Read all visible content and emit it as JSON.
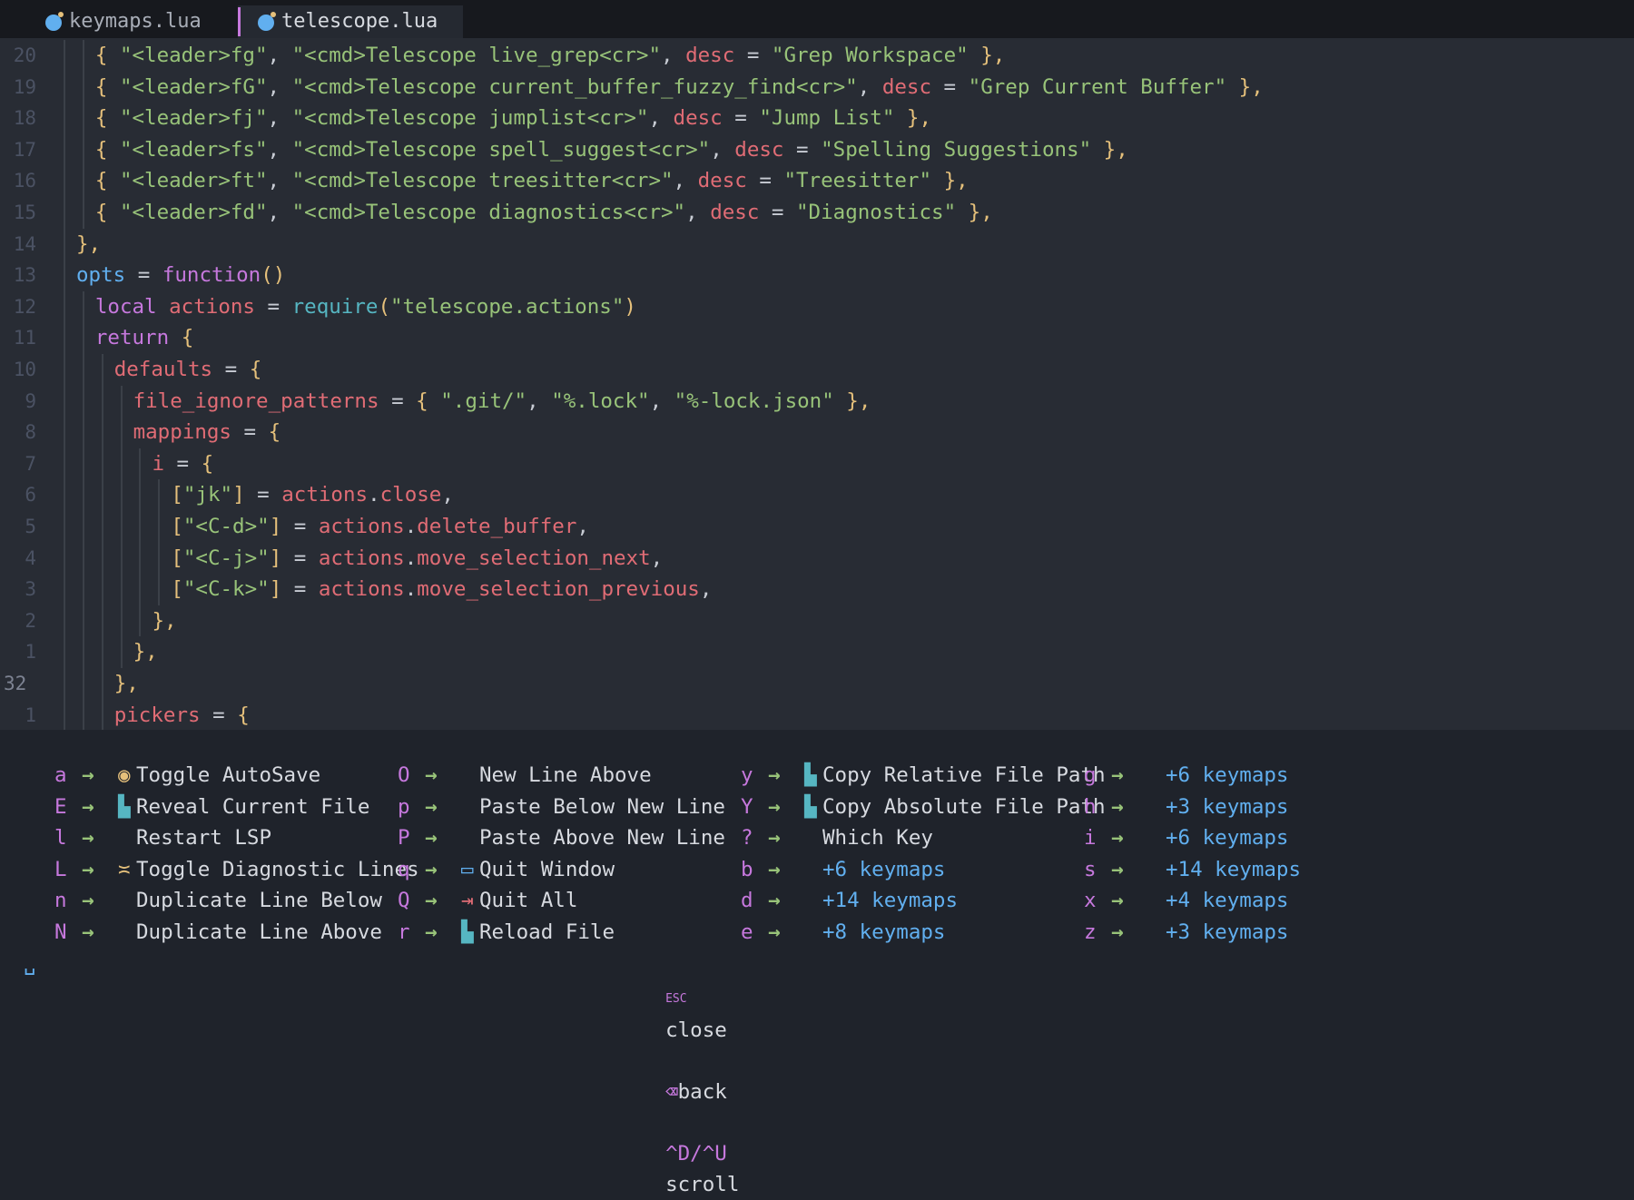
{
  "tabs": [
    {
      "label": "keymaps.lua",
      "active": false
    },
    {
      "label": "telescope.lua",
      "active": true
    }
  ],
  "lines": [
    {
      "num": "20",
      "indent": 2,
      "tokens": [
        [
          "{ ",
          "brace"
        ],
        [
          "\"<leader>fg\"",
          "str"
        ],
        [
          ", ",
          "punc"
        ],
        [
          "\"<cmd>Telescope live_grep<cr>\"",
          "str"
        ],
        [
          ", ",
          "punc"
        ],
        [
          "desc",
          "field"
        ],
        [
          " = ",
          "punc"
        ],
        [
          "\"Grep Workspace\"",
          "str"
        ],
        [
          " },",
          "brace"
        ]
      ]
    },
    {
      "num": "19",
      "indent": 2,
      "tokens": [
        [
          "{ ",
          "brace"
        ],
        [
          "\"<leader>fG\"",
          "str"
        ],
        [
          ", ",
          "punc"
        ],
        [
          "\"<cmd>Telescope current_buffer_fuzzy_find<cr>\"",
          "str"
        ],
        [
          ", ",
          "punc"
        ],
        [
          "desc",
          "field"
        ],
        [
          " = ",
          "punc"
        ],
        [
          "\"Grep Current Buffer\"",
          "str"
        ],
        [
          " },",
          "brace"
        ]
      ]
    },
    {
      "num": "18",
      "indent": 2,
      "tokens": [
        [
          "{ ",
          "brace"
        ],
        [
          "\"<leader>fj\"",
          "str"
        ],
        [
          ", ",
          "punc"
        ],
        [
          "\"<cmd>Telescope jumplist<cr>\"",
          "str"
        ],
        [
          ", ",
          "punc"
        ],
        [
          "desc",
          "field"
        ],
        [
          " = ",
          "punc"
        ],
        [
          "\"Jump List\"",
          "str"
        ],
        [
          " },",
          "brace"
        ]
      ]
    },
    {
      "num": "17",
      "indent": 2,
      "tokens": [
        [
          "{ ",
          "brace"
        ],
        [
          "\"<leader>fs\"",
          "str"
        ],
        [
          ", ",
          "punc"
        ],
        [
          "\"<cmd>Telescope spell_suggest<cr>\"",
          "str"
        ],
        [
          ", ",
          "punc"
        ],
        [
          "desc",
          "field"
        ],
        [
          " = ",
          "punc"
        ],
        [
          "\"Spelling Suggestions\"",
          "str"
        ],
        [
          " },",
          "brace"
        ]
      ]
    },
    {
      "num": "16",
      "indent": 2,
      "tokens": [
        [
          "{ ",
          "brace"
        ],
        [
          "\"<leader>ft\"",
          "str"
        ],
        [
          ", ",
          "punc"
        ],
        [
          "\"<cmd>Telescope treesitter<cr>\"",
          "str"
        ],
        [
          ", ",
          "punc"
        ],
        [
          "desc",
          "field"
        ],
        [
          " = ",
          "punc"
        ],
        [
          "\"Treesitter\"",
          "str"
        ],
        [
          " },",
          "brace"
        ]
      ]
    },
    {
      "num": "15",
      "indent": 2,
      "tokens": [
        [
          "{ ",
          "brace"
        ],
        [
          "\"<leader>fd\"",
          "str"
        ],
        [
          ", ",
          "punc"
        ],
        [
          "\"<cmd>Telescope diagnostics<cr>\"",
          "str"
        ],
        [
          ", ",
          "punc"
        ],
        [
          "desc",
          "field"
        ],
        [
          " = ",
          "punc"
        ],
        [
          "\"Diagnostics\"",
          "str"
        ],
        [
          " },",
          "brace"
        ]
      ]
    },
    {
      "num": "14",
      "indent": 1,
      "tokens": [
        [
          "},",
          "brace"
        ]
      ]
    },
    {
      "num": "13",
      "indent": 1,
      "tokens": [
        [
          "opts",
          "key"
        ],
        [
          " = ",
          "punc"
        ],
        [
          "function",
          "kw"
        ],
        [
          "()",
          "brace"
        ]
      ]
    },
    {
      "num": "12",
      "indent": 2,
      "tokens": [
        [
          "local ",
          "kw"
        ],
        [
          "actions",
          "field"
        ],
        [
          " = ",
          "punc"
        ],
        [
          "require",
          "fn"
        ],
        [
          "(",
          "brace"
        ],
        [
          "\"telescope.actions\"",
          "str"
        ],
        [
          ")",
          "brace"
        ]
      ]
    },
    {
      "num": "11",
      "indent": 2,
      "tokens": [
        [
          "return ",
          "kw"
        ],
        [
          "{",
          "brace"
        ]
      ]
    },
    {
      "num": "10",
      "indent": 3,
      "tokens": [
        [
          "defaults",
          "field"
        ],
        [
          " = ",
          "punc"
        ],
        [
          "{",
          "brace"
        ]
      ]
    },
    {
      "num": "9",
      "indent": 4,
      "tokens": [
        [
          "file_ignore_patterns",
          "field"
        ],
        [
          " = ",
          "punc"
        ],
        [
          "{ ",
          "brace"
        ],
        [
          "\".git/\"",
          "str"
        ],
        [
          ", ",
          "punc"
        ],
        [
          "\"%.lock\"",
          "str"
        ],
        [
          ", ",
          "punc"
        ],
        [
          "\"%-lock.json\"",
          "str"
        ],
        [
          " },",
          "brace"
        ]
      ]
    },
    {
      "num": "8",
      "indent": 4,
      "tokens": [
        [
          "mappings",
          "field"
        ],
        [
          " = ",
          "punc"
        ],
        [
          "{",
          "brace"
        ]
      ]
    },
    {
      "num": "7",
      "indent": 5,
      "tokens": [
        [
          "i",
          "field"
        ],
        [
          " = ",
          "punc"
        ],
        [
          "{",
          "brace"
        ]
      ]
    },
    {
      "num": "6",
      "indent": 6,
      "tokens": [
        [
          "[",
          "brace"
        ],
        [
          "\"jk\"",
          "str"
        ],
        [
          "]",
          "brace"
        ],
        [
          " = ",
          "punc"
        ],
        [
          "actions",
          "field"
        ],
        [
          ".",
          "punc"
        ],
        [
          "close",
          "field"
        ],
        [
          ",",
          "punc"
        ]
      ]
    },
    {
      "num": "5",
      "indent": 6,
      "tokens": [
        [
          "[",
          "brace"
        ],
        [
          "\"<C-d>\"",
          "str"
        ],
        [
          "]",
          "brace"
        ],
        [
          " = ",
          "punc"
        ],
        [
          "actions",
          "field"
        ],
        [
          ".",
          "punc"
        ],
        [
          "delete_buffer",
          "field"
        ],
        [
          ",",
          "punc"
        ]
      ]
    },
    {
      "num": "4",
      "indent": 6,
      "tokens": [
        [
          "[",
          "brace"
        ],
        [
          "\"<C-j>\"",
          "str"
        ],
        [
          "]",
          "brace"
        ],
        [
          " = ",
          "punc"
        ],
        [
          "actions",
          "field"
        ],
        [
          ".",
          "punc"
        ],
        [
          "move_selection_next",
          "field"
        ],
        [
          ",",
          "punc"
        ]
      ]
    },
    {
      "num": "3",
      "indent": 6,
      "tokens": [
        [
          "[",
          "brace"
        ],
        [
          "\"<C-k>\"",
          "str"
        ],
        [
          "]",
          "brace"
        ],
        [
          " = ",
          "punc"
        ],
        [
          "actions",
          "field"
        ],
        [
          ".",
          "punc"
        ],
        [
          "move_selection_previous",
          "field"
        ],
        [
          ",",
          "punc"
        ]
      ]
    },
    {
      "num": "2",
      "indent": 5,
      "tokens": [
        [
          "},",
          "brace"
        ]
      ]
    },
    {
      "num": "1",
      "indent": 4,
      "tokens": [
        [
          "},",
          "brace"
        ]
      ]
    },
    {
      "num": "32",
      "indent": 3,
      "current": true,
      "tokens": [
        [
          "},",
          "brace"
        ]
      ]
    },
    {
      "num": "1",
      "indent": 3,
      "tokens": [
        [
          "pickers",
          "field"
        ],
        [
          " = ",
          "punc"
        ],
        [
          "{",
          "brace"
        ]
      ]
    }
  ],
  "whichkey": {
    "columns": [
      [
        {
          "key": "a",
          "icon": "toggle-icon",
          "desc": "Toggle AutoSave",
          "group": false
        },
        {
          "key": "E",
          "icon": "file-icon",
          "desc": "Reveal Current File",
          "group": false
        },
        {
          "key": "l",
          "icon": "",
          "desc": "Restart LSP",
          "group": false
        },
        {
          "key": "L",
          "icon": "list-toggle-icon",
          "desc": "Toggle Diagnostic Lines",
          "group": false
        },
        {
          "key": "n",
          "icon": "",
          "desc": "Duplicate Line Below",
          "group": false
        },
        {
          "key": "N",
          "icon": "",
          "desc": "Duplicate Line Above",
          "group": false
        }
      ],
      [
        {
          "key": "O",
          "icon": "",
          "desc": "New Line Above",
          "group": false
        },
        {
          "key": "p",
          "icon": "",
          "desc": "Paste Below New Line",
          "group": false
        },
        {
          "key": "P",
          "icon": "",
          "desc": "Paste Above New Line",
          "group": false
        },
        {
          "key": "q",
          "icon": "window-icon",
          "desc": "Quit Window",
          "group": false
        },
        {
          "key": "Q",
          "icon": "exit-icon",
          "desc": "Quit All",
          "group": false
        },
        {
          "key": "r",
          "icon": "file-icon",
          "desc": "Reload File",
          "group": false
        }
      ],
      [
        {
          "key": "y",
          "icon": "file-icon",
          "desc": "Copy Relative File Path",
          "group": false
        },
        {
          "key": "Y",
          "icon": "file-icon",
          "desc": "Copy Absolute File Path",
          "group": false
        },
        {
          "key": "?",
          "icon": "",
          "desc": "Which Key",
          "group": false
        },
        {
          "key": "b",
          "icon": "",
          "desc": "+6 keymaps",
          "group": true
        },
        {
          "key": "d",
          "icon": "",
          "desc": "+14 keymaps",
          "group": true
        },
        {
          "key": "e",
          "icon": "",
          "desc": "+8 keymaps",
          "group": true
        }
      ],
      [
        {
          "key": "g",
          "icon": "",
          "desc": "+6 keymaps",
          "group": true
        },
        {
          "key": "h",
          "icon": "",
          "desc": "+3 keymaps",
          "group": true
        },
        {
          "key": "i",
          "icon": "",
          "desc": "+6 keymaps",
          "group": true
        },
        {
          "key": "s",
          "icon": "",
          "desc": "+14 keymaps",
          "group": true
        },
        {
          "key": "x",
          "icon": "",
          "desc": "+4 keymaps",
          "group": true
        },
        {
          "key": "z",
          "icon": "",
          "desc": "+3 keymaps",
          "group": true
        }
      ]
    ],
    "footer": {
      "close_key": "ESC",
      "close_label": "close",
      "back_key": "⌫",
      "back_label": "back",
      "scroll_key": "^D/^U",
      "scroll_label": "scroll"
    },
    "space_glyph": "␣"
  },
  "colors": {
    "key": "#c678dd",
    "arrow": "#98c379",
    "group": "#61afef",
    "string": "#98c379",
    "field": "#e06c75"
  }
}
